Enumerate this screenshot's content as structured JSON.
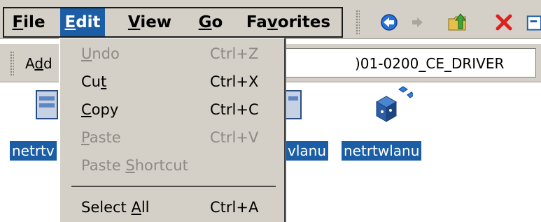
{
  "menubar": {
    "items": [
      {
        "label": "File",
        "accel": "F",
        "rest": "ile",
        "active": false
      },
      {
        "label": "Edit",
        "accel": "E",
        "rest": "dit",
        "active": true
      },
      {
        "label": "View",
        "accel": "V",
        "rest": "iew",
        "active": false
      },
      {
        "label": "Go",
        "accel": "G",
        "rest": "o",
        "active": false
      },
      {
        "label": "Favorites",
        "pre": "Fa",
        "accel": "v",
        "rest": "orites",
        "active": false
      }
    ]
  },
  "toolbar": {
    "buttons": [
      {
        "name": "back-arrow-icon",
        "enabled": true
      },
      {
        "name": "forward-arrow-icon",
        "enabled": false
      },
      {
        "name": "up-folder-icon",
        "enabled": true
      },
      {
        "name": "delete-x-icon",
        "enabled": true
      }
    ]
  },
  "address": {
    "label": "Address",
    "label_pre": "A",
    "label_accel": "d",
    "label_rest": "d",
    "path_visible": ")01-0200_CE_DRIVER"
  },
  "files": [
    {
      "name": "netrtwlanu",
      "visible_label": "netrtv"
    },
    {
      "name": "netrtwlanu",
      "visible_label": "vlanu"
    },
    {
      "name": "netrtwlanu",
      "visible_label": "netrtwlanu"
    }
  ],
  "edit_menu": {
    "undo": {
      "pre": "",
      "accel": "U",
      "rest": "ndo",
      "shortcut": "Ctrl+Z",
      "enabled": false
    },
    "cut": {
      "pre": "Cu",
      "accel": "t",
      "rest": "",
      "shortcut": "Ctrl+X",
      "enabled": true
    },
    "copy": {
      "pre": "",
      "accel": "C",
      "rest": "opy",
      "shortcut": "Ctrl+C",
      "enabled": true
    },
    "paste": {
      "pre": "",
      "accel": "P",
      "rest": "aste",
      "shortcut": "Ctrl+V",
      "enabled": false
    },
    "paste_shortcut": {
      "pre": "Paste ",
      "accel": "S",
      "rest": "hortcut",
      "shortcut": "",
      "enabled": false
    },
    "select_all": {
      "pre": "Select ",
      "accel": "A",
      "rest": "ll",
      "shortcut": "Ctrl+A",
      "enabled": true
    }
  },
  "colors": {
    "selection": "#1c5ea5",
    "chrome": "#d4d0c8",
    "disabled_text": "#8c8a85"
  }
}
